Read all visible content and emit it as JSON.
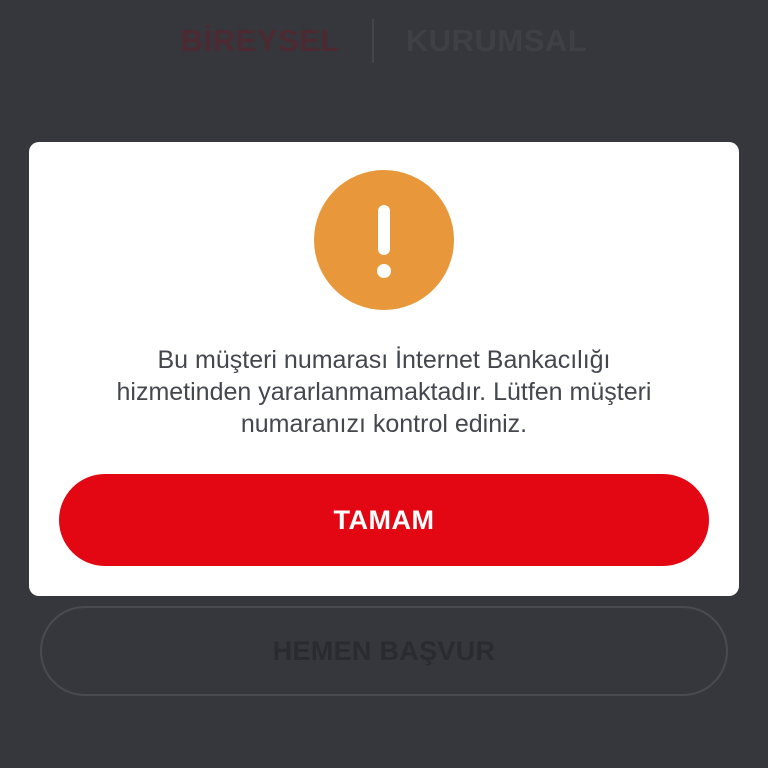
{
  "segment": {
    "personal_label": "BİREYSEL",
    "corporate_label": "KURUMSAL"
  },
  "background": {
    "apply_label": "HEMEN BAŞVUR"
  },
  "dialog": {
    "icon": "exclamation-warning-icon",
    "message_lines": [
      "Bu müşteri numarası İnternet Bankacılığı",
      "hizmetinden yararlanmamaktadır. Lütfen müşteri",
      "numaranızı kontrol ediniz."
    ],
    "ok_label": "TAMAM"
  },
  "colors": {
    "brand_red": "#e30613",
    "warning_orange": "#e8973a",
    "overlay_background": "#36373d"
  }
}
